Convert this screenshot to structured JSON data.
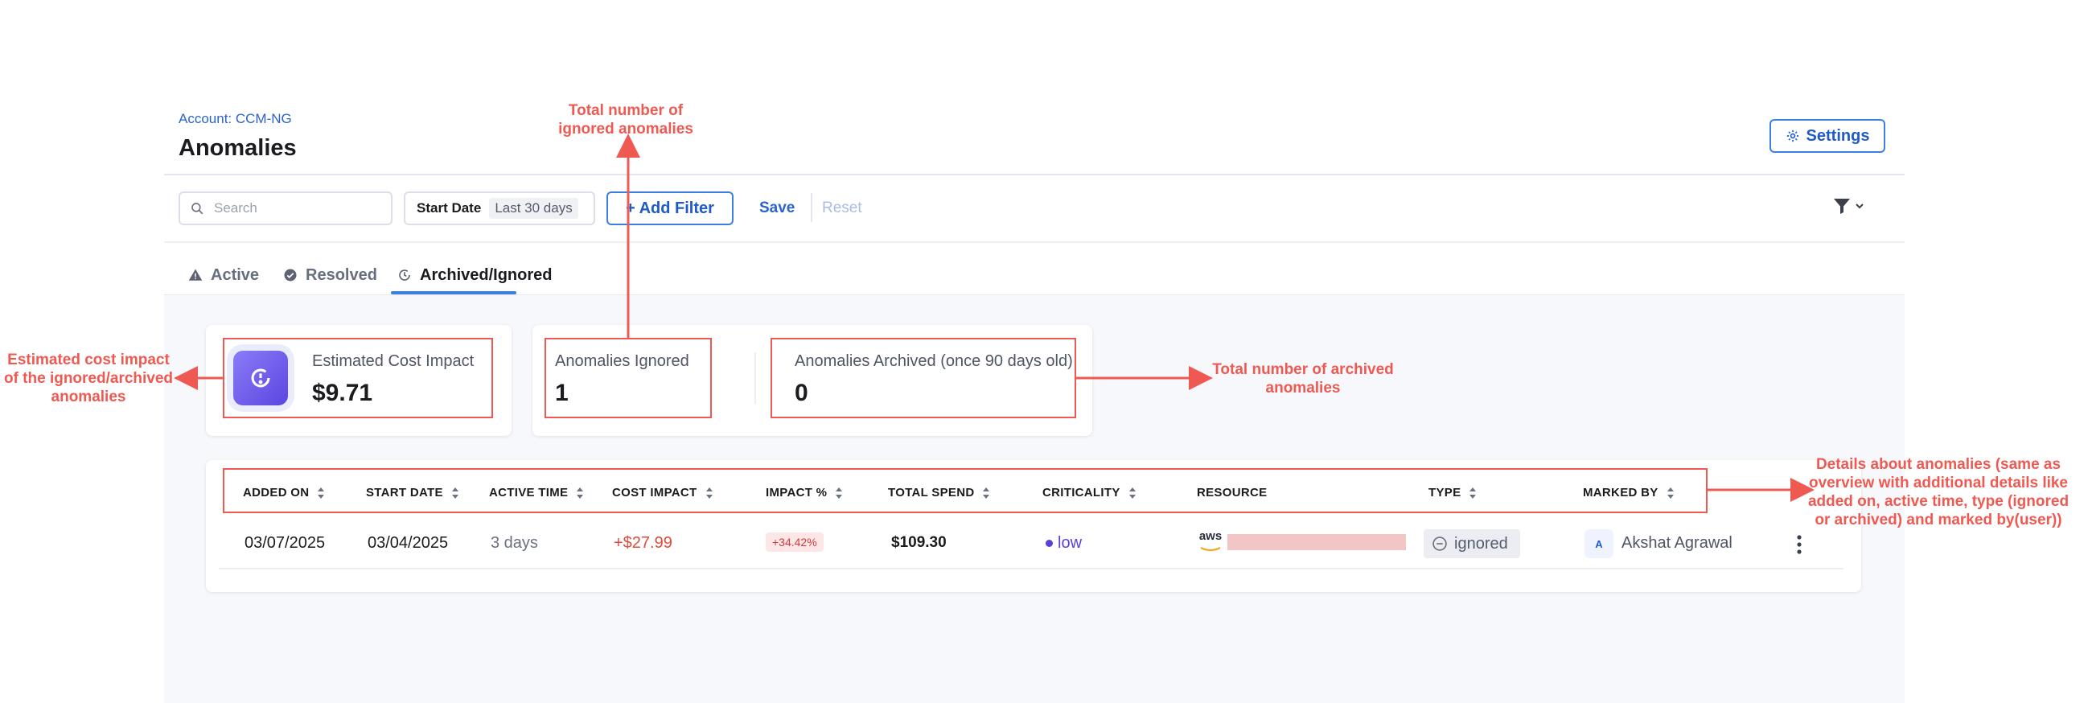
{
  "header": {
    "breadcrumb": "Account: CCM-NG",
    "title": "Anomalies",
    "settings_label": "Settings"
  },
  "toolbar": {
    "search_placeholder": "Search",
    "date_filter_label": "Start Date",
    "date_filter_value": "Last 30 days",
    "add_filter_label": "+ Add Filter",
    "save_label": "Save",
    "reset_label": "Reset"
  },
  "tabs": [
    {
      "label": "Active",
      "icon": "warning-icon"
    },
    {
      "label": "Resolved",
      "icon": "check-circle-icon"
    },
    {
      "label": "Archived/Ignored",
      "icon": "archive-clock-icon",
      "active": true
    }
  ],
  "summary": {
    "cost_label": "Estimated Cost Impact",
    "cost_value": "$9.71",
    "ignored_label": "Anomalies Ignored",
    "ignored_value": "1",
    "archived_label": "Anomalies Archived (once 90 days old)",
    "archived_value": "0"
  },
  "table": {
    "columns": [
      "ADDED ON",
      "START DATE",
      "ACTIVE TIME",
      "COST IMPACT",
      "IMPACT %",
      "TOTAL SPEND",
      "CRITICALITY",
      "RESOURCE",
      "TYPE",
      "MARKED BY"
    ],
    "rows": [
      {
        "added_on": "03/07/2025",
        "start_date": "03/04/2025",
        "active_time": "3 days",
        "cost_impact": "+$27.99",
        "impact_pct": "+34.42%",
        "total_spend": "$109.30",
        "criticality": "low",
        "resource_provider": "aws",
        "type": "ignored",
        "marked_by_initial": "A",
        "marked_by": "Akshat Agrawal"
      }
    ]
  },
  "annotations": {
    "ignored_count": "Total number of ignored anomalies",
    "cost_impact": "Estimated cost impact of the ignored/archived anomalies",
    "archived_count": "Total number of archived anomalies",
    "details": "Details about anomalies (same as overview with additional details like added on, active time, type (ignored or archived) and marked by(user))"
  },
  "colors": {
    "accent": "#3d7fe0",
    "annotation": "#ee5a52",
    "cost_impact": "#e04a3a",
    "criticality_low": "#5b3fd6"
  }
}
